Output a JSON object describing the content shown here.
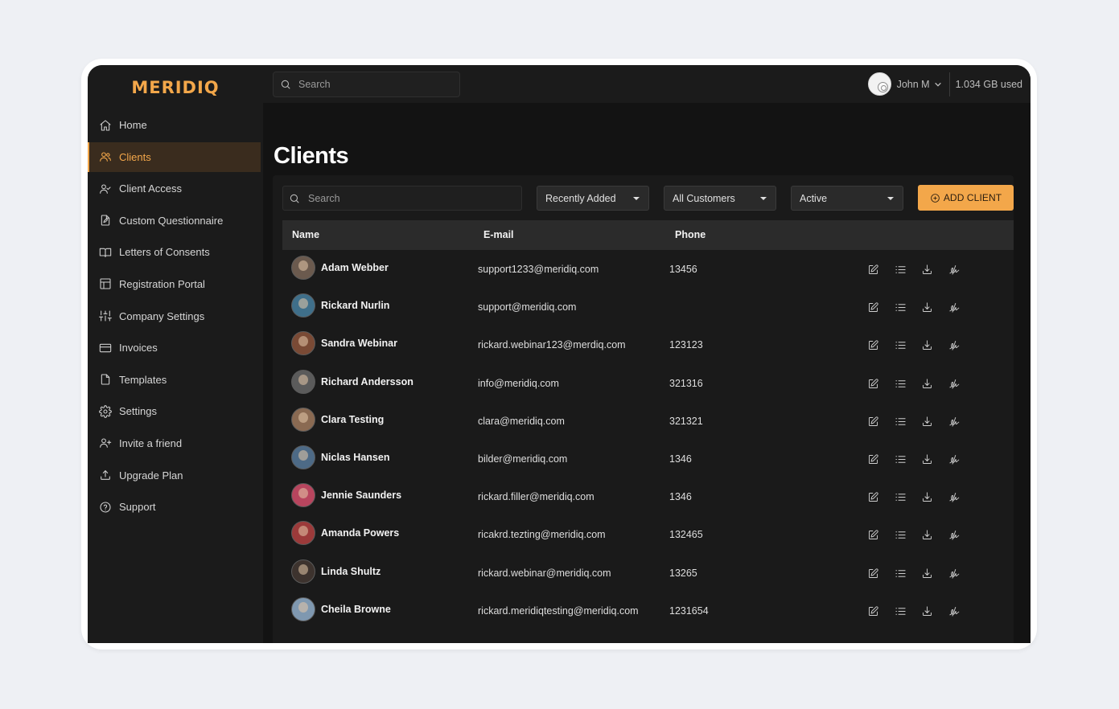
{
  "app": {
    "logo": "MERIDIQ",
    "accent": "#f3a74a"
  },
  "topbar": {
    "search_placeholder": "Search",
    "user_name": "John M",
    "storage": "1.034 GB used"
  },
  "sidebar": {
    "items": [
      {
        "label": "Home",
        "icon": "home-icon",
        "active": false
      },
      {
        "label": "Clients",
        "icon": "users-icon",
        "active": true
      },
      {
        "label": "Client Access",
        "icon": "user-check-icon",
        "active": false
      },
      {
        "label": "Custom Questionnaire",
        "icon": "file-edit-icon",
        "active": false
      },
      {
        "label": "Letters of Consents",
        "icon": "book-open-icon",
        "active": false
      },
      {
        "label": "Registration Portal",
        "icon": "layout-icon",
        "active": false
      },
      {
        "label": "Company Settings",
        "icon": "sliders-icon",
        "active": false
      },
      {
        "label": "Invoices",
        "icon": "credit-card-icon",
        "active": false
      },
      {
        "label": "Templates",
        "icon": "file-icon",
        "active": false
      },
      {
        "label": "Settings",
        "icon": "gear-icon",
        "active": false
      },
      {
        "label": "Invite a friend",
        "icon": "user-plus-icon",
        "active": false
      },
      {
        "label": "Upgrade Plan",
        "icon": "upload-icon",
        "active": false
      },
      {
        "label": "Support",
        "icon": "help-circle-icon",
        "active": false
      }
    ]
  },
  "main": {
    "title": "Clients",
    "search_placeholder": "Search",
    "filters": {
      "sort": "Recently Added",
      "customers": "All Customers",
      "status": "Active"
    },
    "add_button": "ADD CLIENT",
    "columns": {
      "name": "Name",
      "email": "E-mail",
      "phone": "Phone"
    },
    "clients": [
      {
        "name": "Adam Webber",
        "email": "support1233@meridiq.com",
        "phone": "13456",
        "avatar_color": "#6b5a4e"
      },
      {
        "name": "Rickard Nurlin",
        "email": "support@meridiq.com",
        "phone": "",
        "avatar_color": "#3f6f8a"
      },
      {
        "name": "Sandra Webinar",
        "email": "rickard.webinar123@merdiq.com",
        "phone": "123123",
        "avatar_color": "#7a4a35"
      },
      {
        "name": "Richard Andersson",
        "email": "info@meridiq.com",
        "phone": "321316",
        "avatar_color": "#5b5b5b"
      },
      {
        "name": "Clara Testing",
        "email": "clara@meridiq.com",
        "phone": "321321",
        "avatar_color": "#8a6a52"
      },
      {
        "name": "Niclas Hansen",
        "email": "bilder@meridiq.com",
        "phone": "1346",
        "avatar_color": "#4d6a86"
      },
      {
        "name": "Jennie Saunders",
        "email": "rickard.filler@meridiq.com",
        "phone": "1346",
        "avatar_color": "#b8455e"
      },
      {
        "name": "Amanda Powers",
        "email": "ricakrd.tezting@meridiq.com",
        "phone": "132465",
        "avatar_color": "#9c3a3a"
      },
      {
        "name": "Linda Shultz",
        "email": "rickard.webinar@meridiq.com",
        "phone": "13265",
        "avatar_color": "#3d332e"
      },
      {
        "name": "Cheila Browne",
        "email": "rickard.meridiqtesting@meridiq.com",
        "phone": "1231654",
        "avatar_color": "#7f98b0"
      }
    ],
    "row_actions": [
      "edit-icon",
      "list-icon",
      "download-icon",
      "signature-icon"
    ]
  }
}
